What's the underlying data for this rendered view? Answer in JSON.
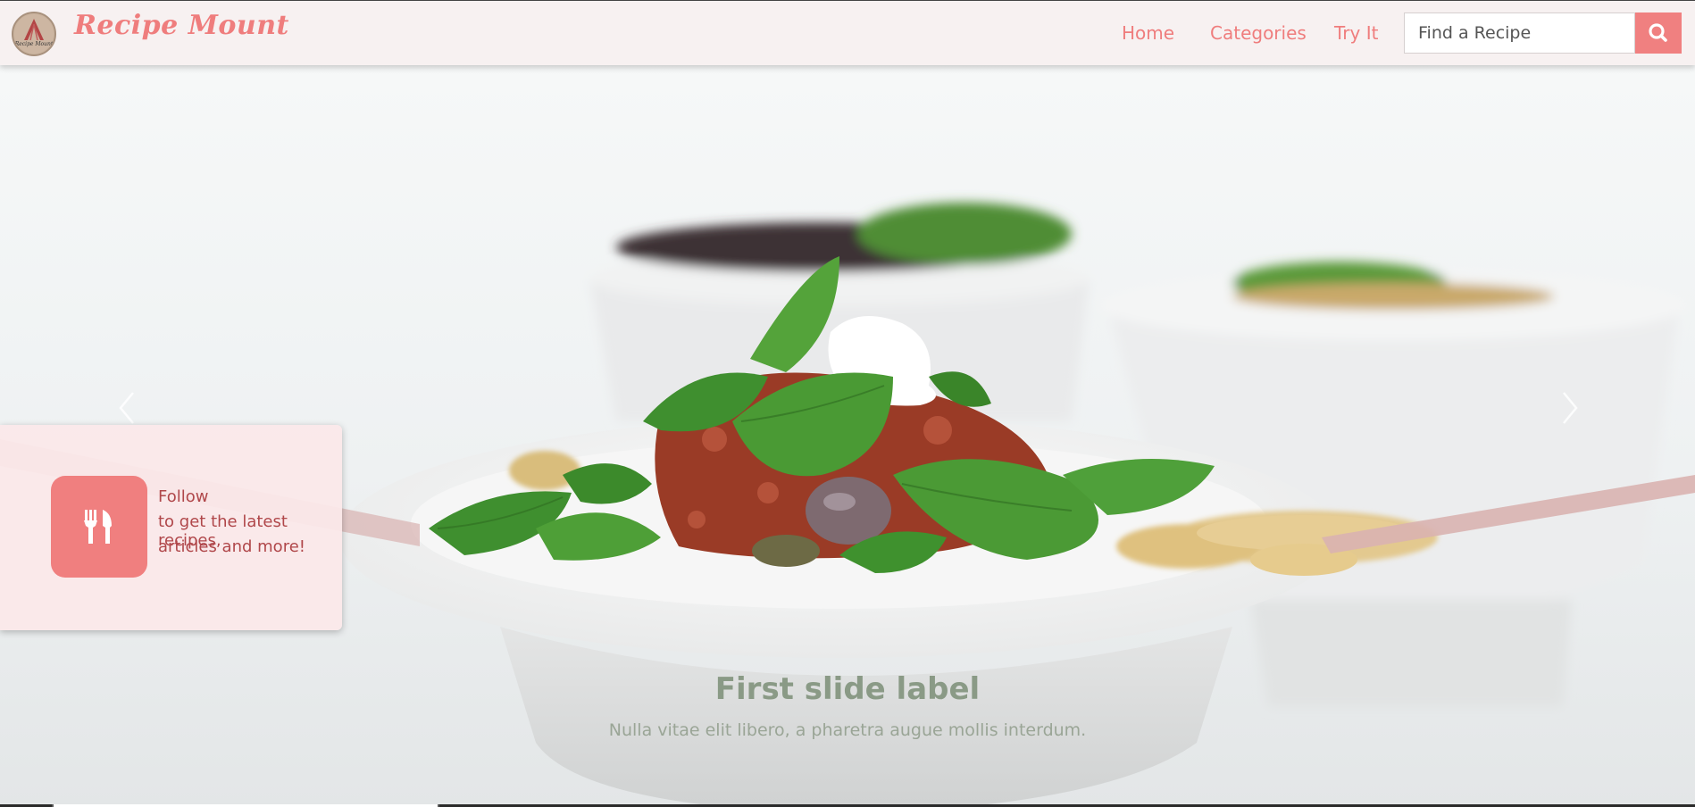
{
  "brand": {
    "name": "Recipe Mount",
    "logo_text": "Recipe Mount"
  },
  "nav": {
    "links": [
      {
        "label": "Home"
      },
      {
        "label": "Categories"
      },
      {
        "label": "Try It"
      }
    ],
    "search": {
      "placeholder": "Find a Recipe",
      "value": "",
      "button_icon": "search-icon"
    }
  },
  "hero": {
    "caption_title": "First slide label",
    "caption_text": "Nulla vitae elit libero, a pharetra augue mollis interdum.",
    "prev_icon": "chevron-left-icon",
    "next_icon": "chevron-right-icon",
    "indicators_active": 1
  },
  "follow_card": {
    "icon": "fork-knife-icon",
    "line1": "Follow",
    "line2": "to get the latest recipes,",
    "line3": "articles and more!"
  },
  "colors": {
    "accent": "#ef7d7d",
    "navbar_bg": "#f7f1f1",
    "card_bg": "#fbe8e9",
    "caption_title": "#8a9a86"
  }
}
